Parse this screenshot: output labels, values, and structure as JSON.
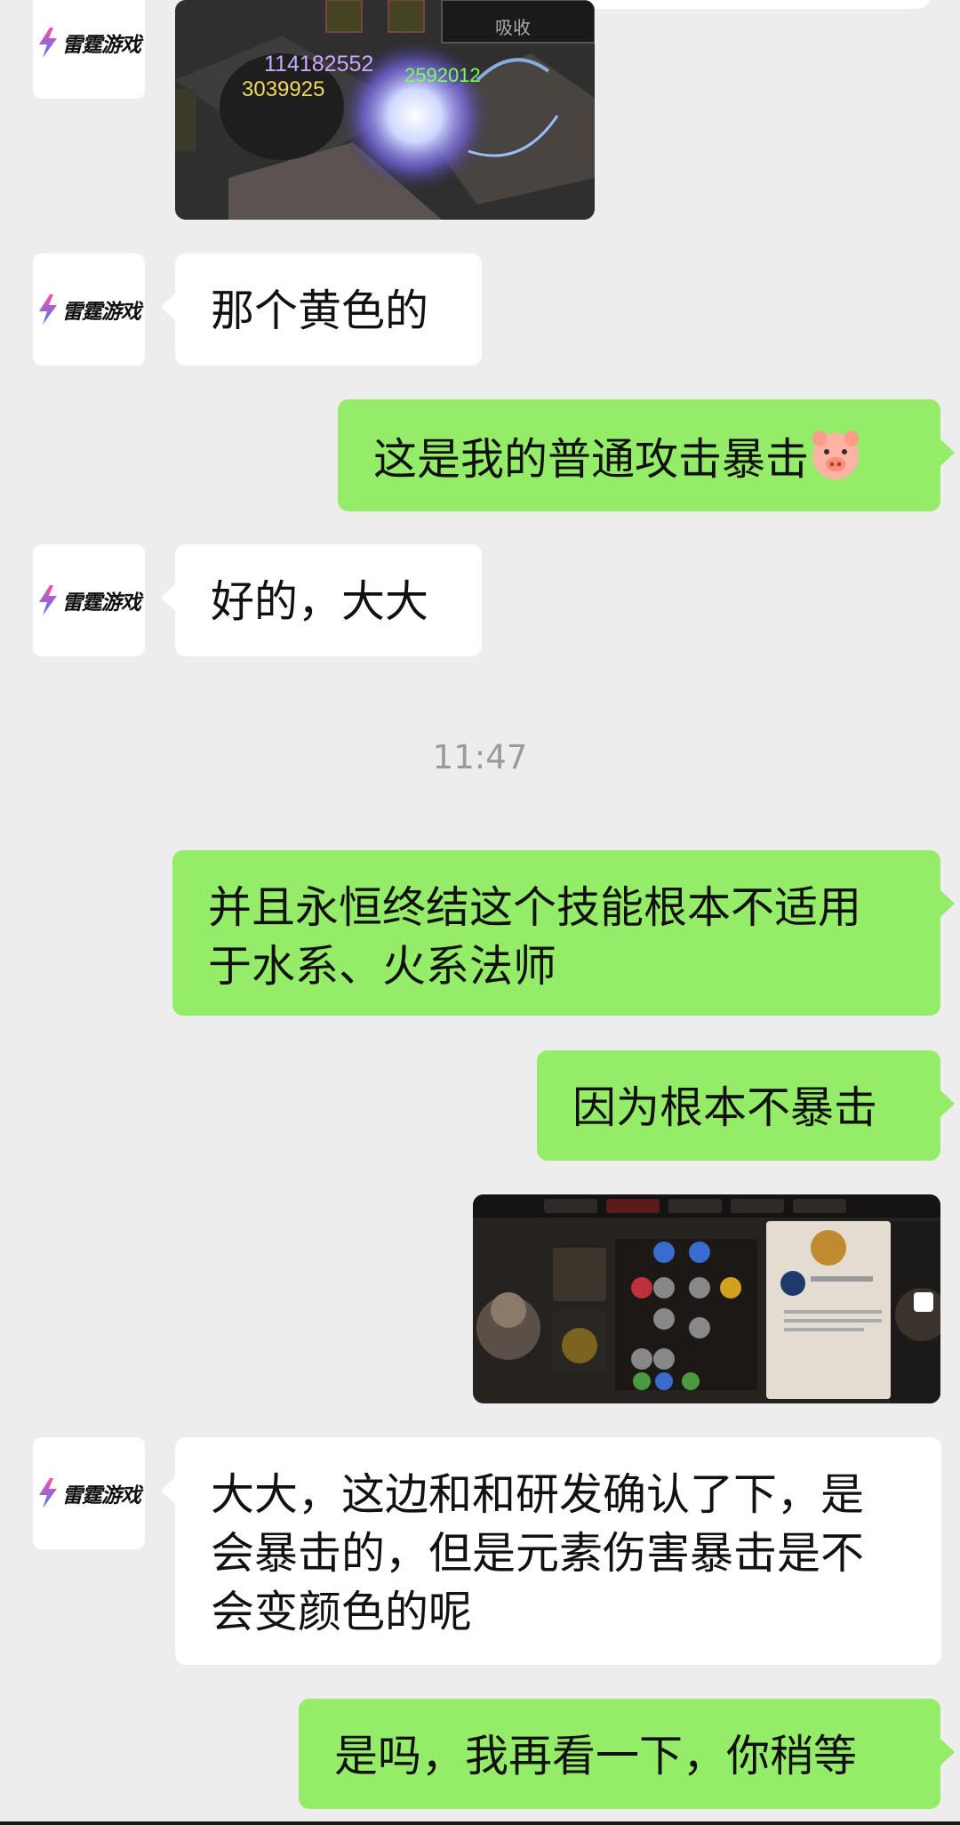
{
  "chat": {
    "contact_logo_text": "雷霆游戏",
    "timestamp": "11:47",
    "messages": [
      {
        "side": "left",
        "type": "image",
        "overlay": {
          "game_numbers": [
            "114182552",
            "3039925",
            "2592012"
          ],
          "button_label": "吸收"
        }
      },
      {
        "side": "left",
        "type": "text",
        "text": "那个黄色的"
      },
      {
        "side": "right",
        "type": "text",
        "text": "这是我的普通攻击暴击",
        "emoji": "pig-face"
      },
      {
        "side": "left",
        "type": "text",
        "text": "好的，大大"
      },
      {
        "side": "right",
        "type": "text",
        "lines": [
          "并且永恒终结这个技能根本不适用",
          "于水系、火系法师"
        ]
      },
      {
        "side": "right",
        "type": "text",
        "text": "因为根本不暴击"
      },
      {
        "side": "right",
        "type": "image",
        "description_icon": "game-skill-tree-screenshot"
      },
      {
        "side": "left",
        "type": "text",
        "lines": [
          "大大，这边和和研发确认了下，是",
          "会暴击的，但是元素伤害暴击是不",
          "会变颜色的呢"
        ]
      },
      {
        "side": "right",
        "type": "text",
        "text": "是吗，我再看一下，你稍等"
      }
    ]
  },
  "colors": {
    "bubble_sent": "#95ec69",
    "bubble_received": "#ffffff",
    "background": "#ededed",
    "timestamp": "#9a9a9a"
  }
}
